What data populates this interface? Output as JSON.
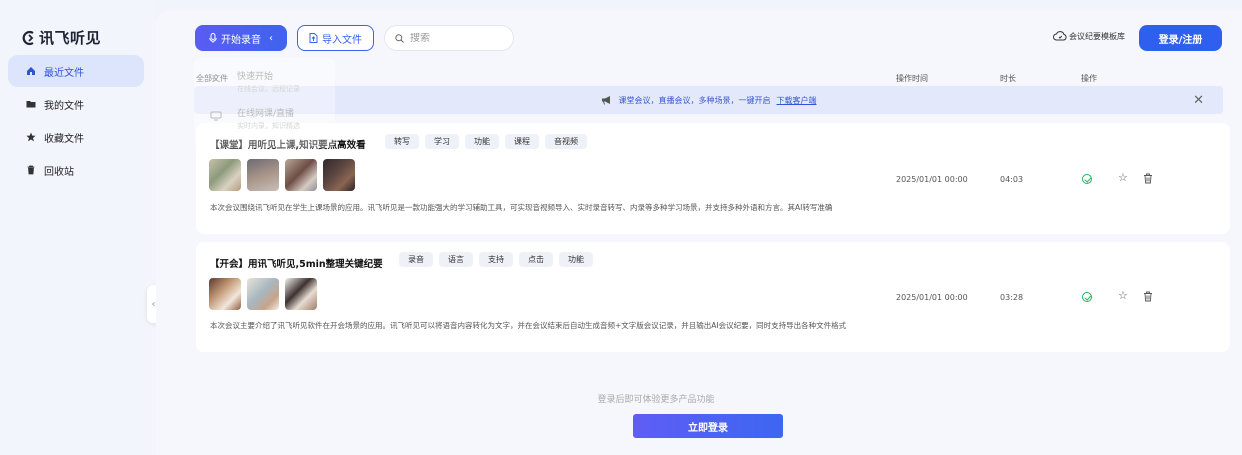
{
  "app": {
    "logo_text": "讯飞听见"
  },
  "sidebar": {
    "items": [
      {
        "label": "最近文件",
        "icon": "home-icon",
        "active": true
      },
      {
        "label": "我的文件",
        "icon": "folder-icon",
        "active": false
      },
      {
        "label": "收藏文件",
        "icon": "star-icon",
        "active": false
      },
      {
        "label": "回收站",
        "icon": "trash-icon",
        "active": false
      }
    ]
  },
  "toolbar": {
    "record_label": "开始录音",
    "import_label": "导入文件",
    "search_placeholder": "搜索",
    "templates_label": "会议纪要模板库",
    "login_label": "登录/注册"
  },
  "dropdown": {
    "items": [
      {
        "title": "快速开始",
        "sub": "在线会议、远程记录"
      },
      {
        "title": "在线网课/直播",
        "sub": "实时内录，知识精选"
      }
    ]
  },
  "table": {
    "headers": {
      "name": "全部文件",
      "time": "操作时间",
      "duration": "时长",
      "action": "操作"
    }
  },
  "notice": {
    "text": "课堂会议，直播会议，多种场景，一键开启",
    "link": "下载客户端"
  },
  "files": [
    {
      "title": "【课堂】用听见上课,知识要点高效看",
      "tags": [
        "转写",
        "学习",
        "功能",
        "课程",
        "音视频"
      ],
      "description": "本次会议围绕讯飞听见在学生上课场景的应用。讯飞听见是一款功能强大的学习辅助工具，可实现音视频导入、实时录音转写、内录等多种学习场景，并支持多种外语和方言。其AI转写准确",
      "time": "2025/01/01 00:00",
      "duration": "04:03"
    },
    {
      "title": "【开会】用讯飞听见,5min整理关键纪要",
      "tags": [
        "录音",
        "语言",
        "支持",
        "点击",
        "功能"
      ],
      "description": "本次会议主要介绍了讯飞听见软件在开会场景的应用。讯飞听见可以将语音内容转化为文字，并在会议结束后自动生成音频+文字版会议记录，并且输出AI会议纪要，同时支持导出各种文件格式",
      "time": "2025/01/01 00:00",
      "duration": "03:28"
    }
  ],
  "footer": {
    "hint": "登录后即可体验更多产品功能",
    "login_now": "立即登录"
  },
  "colors": {
    "primary": "#2f5fee",
    "success": "#22b35e",
    "active_bg": "#dce5fb"
  }
}
